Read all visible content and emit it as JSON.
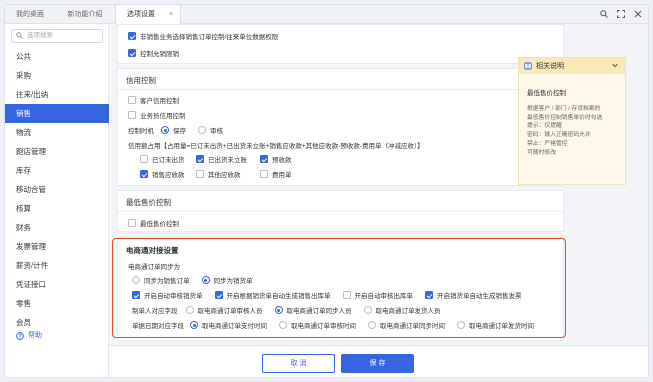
{
  "tabs": [
    {
      "label": "我的桌面"
    },
    {
      "label": "新功能介绍"
    },
    {
      "label": "选项设置",
      "close": "×"
    }
  ],
  "sidebar": {
    "search_placeholder": "选项搜索",
    "items": [
      {
        "label": "公共"
      },
      {
        "label": "采购"
      },
      {
        "label": "往来/出纳"
      },
      {
        "label": "销售",
        "active": true
      },
      {
        "label": "物流"
      },
      {
        "label": "跑店管理"
      },
      {
        "label": "库存"
      },
      {
        "label": "移动合管"
      },
      {
        "label": "核算"
      },
      {
        "label": "财务"
      },
      {
        "label": "发票管理"
      },
      {
        "label": "薪资/计件"
      },
      {
        "label": "凭证接口"
      },
      {
        "label": "零售"
      },
      {
        "label": "会员"
      }
    ],
    "help_label": "帮助"
  },
  "top_section": {
    "items": [
      {
        "label": "非销售业务选择销售订单控制/往来单位数据权限",
        "checked": true
      },
      {
        "label": "控制允销限销",
        "checked": true
      }
    ]
  },
  "credit": {
    "title": "信用控制",
    "customer_credit": {
      "label": "客户信用控制",
      "checked": false
    },
    "salesman_credit": {
      "label": "业务员信用控制",
      "checked": false
    },
    "timing_label": "控制时机",
    "timing_options": [
      {
        "label": "保存",
        "selected": true
      },
      {
        "label": "审核",
        "selected": false
      }
    ],
    "formula": "信用额占用【占用量=已订未出货+已出货未立账+销售应收款+其他应收款-预收款-费用单（冲减应收）】",
    "occupy_row1": [
      {
        "label": "已订未出货",
        "checked": false
      },
      {
        "label": "已出货未立账",
        "checked": true
      },
      {
        "label": "预收款",
        "checked": true
      }
    ],
    "occupy_row2": [
      {
        "label": "销售应收款",
        "checked": true
      },
      {
        "label": "其他应收款",
        "checked": false
      },
      {
        "label": "费用单",
        "checked": false
      }
    ]
  },
  "min_price": {
    "title": "最低售价控制",
    "item": {
      "label": "最低售价控制",
      "checked": false
    }
  },
  "ecommerce": {
    "title": "电商通对接设置",
    "sync_label": "电商通订单同步为",
    "sync_options": [
      {
        "label": "同步为销售订单",
        "selected": false
      },
      {
        "label": "同步为销货单",
        "selected": true
      }
    ],
    "auto_options": [
      {
        "label": "开启自动审核销货单",
        "checked": true
      },
      {
        "label": "开启根据销货单自动生成销售出库单",
        "checked": true
      },
      {
        "label": "开启自动审核出库单",
        "checked": false
      },
      {
        "label": "开启销货单自动生成销售发票",
        "checked": true
      }
    ],
    "maker_label": "制单人对应字段",
    "maker_options": [
      {
        "label": "取电商通订单审核人员",
        "selected": false
      },
      {
        "label": "取电商通订单同步人员",
        "selected": true
      },
      {
        "label": "取电商通订单发货人员",
        "selected": false
      }
    ],
    "date_label": "单据日期对应字段",
    "date_options": [
      {
        "label": "取电商通订单支付时间",
        "selected": true
      },
      {
        "label": "取电商通订单审核时间",
        "selected": false
      },
      {
        "label": "取电商通订单同步时间",
        "selected": false
      },
      {
        "label": "取电商通订单发货时间",
        "selected": false
      }
    ]
  },
  "help_panel": {
    "header": "相关说明",
    "title": "最低售价控制",
    "lines": [
      "根据客户 / 部门 / 存货档案的",
      "最低售价控制销售单价时勾选",
      "提示：仅提醒",
      "密码：输入正确密码允许",
      "禁止：严格管控",
      "可随时修改"
    ]
  },
  "footer": {
    "cancel_label": "取 消",
    "save_label": "保 存"
  },
  "colors": {
    "accent": "#3565e0",
    "highlight_border": "#e04b32",
    "help_header": "#f9e8b8"
  }
}
